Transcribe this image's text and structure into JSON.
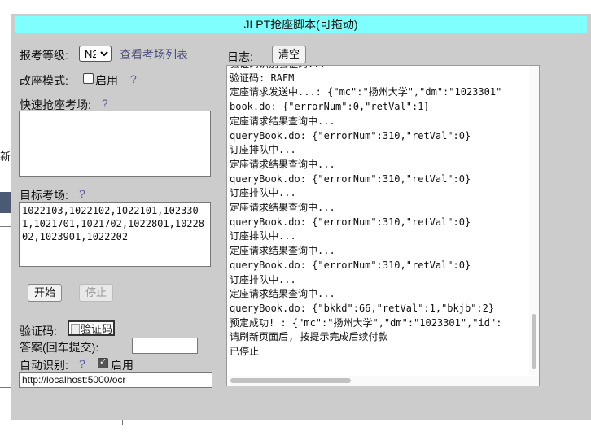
{
  "background": {
    "partial_text": "新"
  },
  "panel": {
    "title": "JLPT抢座脚本(可拖动)",
    "level": {
      "label": "报考等级:",
      "selected": "N2",
      "view_sites_link": "查看考场列表"
    },
    "mode": {
      "label": "改座模式:",
      "checkbox_label": "启用",
      "help": "?"
    },
    "quick_sites": {
      "label": "快速抢座考场:",
      "help": "?",
      "value": ""
    },
    "target_sites": {
      "label": "目标考场:",
      "help": "?",
      "value": "1022103,1022102,1022101,1023301,1021701,1021702,1022801,1022802,1023901,1022202"
    },
    "buttons": {
      "start": "开始",
      "stop": "停止",
      "clear": "清空"
    },
    "captcha": {
      "label": "验证码:",
      "image_alt": "验证码"
    },
    "answer": {
      "label": "答案(回车提交):",
      "value": ""
    },
    "auto_recognize": {
      "label": "自动识别:",
      "help": "?",
      "checkbox_label": "启用",
      "checked": true,
      "url": "http://localhost:5000/ocr"
    },
    "log": {
      "label": "日志:",
      "lines": [
        "验证码识别验证码...",
        "验证码: RAFM",
        "定座请求发送中...: {\"mc\":\"扬州大学\",\"dm\":\"1023301\"",
        "book.do: {\"errorNum\":0,\"retVal\":1}",
        "定座请求结果查询中...",
        "queryBook.do: {\"errorNum\":310,\"retVal\":0}",
        "订座排队中...",
        "定座请求结果查询中...",
        "queryBook.do: {\"errorNum\":310,\"retVal\":0}",
        "订座排队中...",
        "定座请求结果查询中...",
        "queryBook.do: {\"errorNum\":310,\"retVal\":0}",
        "订座排队中...",
        "定座请求结果查询中...",
        "queryBook.do: {\"errorNum\":310,\"retVal\":0}",
        "订座排队中...",
        "定座请求结果查询中...",
        "queryBook.do: {\"bkkd\":66,\"retVal\":1,\"bkjb\":2}",
        "预定成功! : {\"mc\":\"扬州大学\",\"dm\":\"1023301\",\"id\":",
        "请刷新页面后, 按提示完成后续付款",
        "已停止"
      ]
    }
  }
}
